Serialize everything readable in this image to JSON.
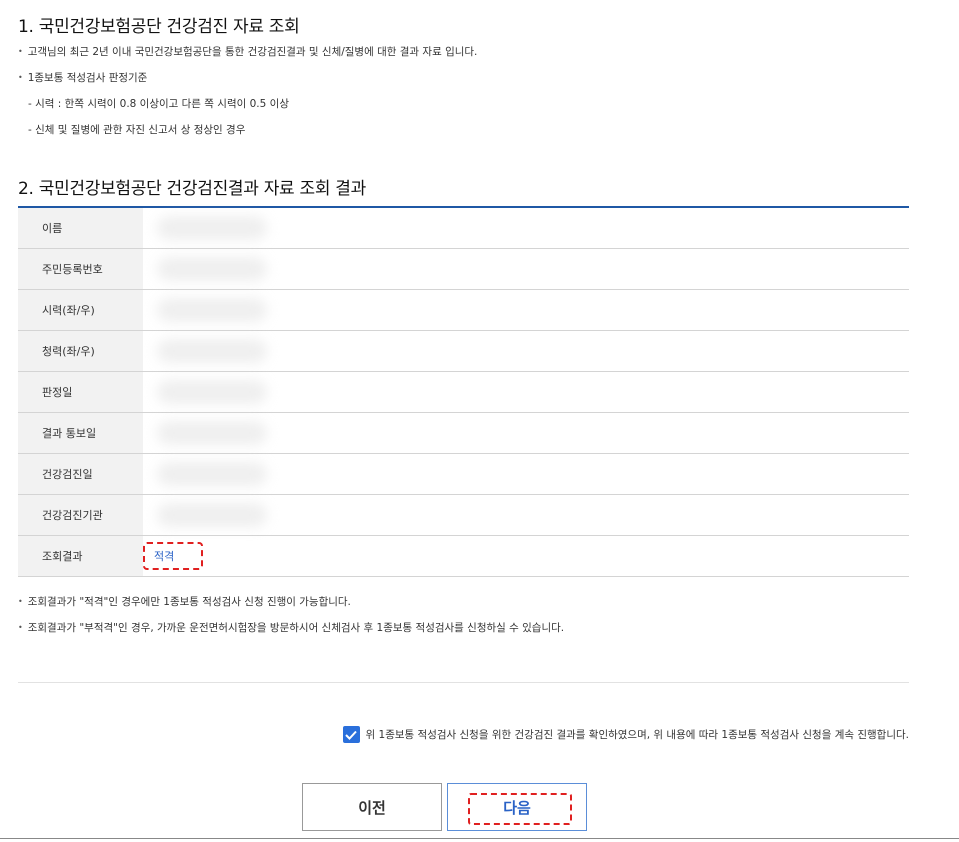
{
  "section1": {
    "title": "1. 국민건강보험공단 건강검진 자료 조회",
    "bullets": [
      "고객님의 최근 2년 이내 국민건강보험공단을 통한 건강검진결과 및 신체/질병에 대한 결과 자료 입니다.",
      "1종보통 적성검사 판정기준"
    ],
    "criteria": [
      "- 시력 : 한쪽 시력이 0.8 이상이고 다른 쪽 시력이 0.5 이상",
      "- 신체 및 질병에 관한 자진 신고서 상 정상인 경우"
    ]
  },
  "section2": {
    "title": "2. 국민건강보험공단 건강검진결과 자료 조회 결과",
    "rows": [
      {
        "label": "이름",
        "value": ""
      },
      {
        "label": "주민등록번호",
        "value": ""
      },
      {
        "label": "시력(좌/우)",
        "value": ""
      },
      {
        "label": "청력(좌/우)",
        "value": ""
      },
      {
        "label": "판정일",
        "value": ""
      },
      {
        "label": "결과 통보일",
        "value": ""
      },
      {
        "label": "건강검진일",
        "value": ""
      },
      {
        "label": "건강검진기관",
        "value": ""
      }
    ],
    "result_label": "조회결과",
    "result_value": "적격"
  },
  "notes": [
    "조회결과가 \"적격\"인 경우에만 1종보통 적성검사 신청 진행이 가능합니다.",
    "조회결과가 \"부적격\"인 경우, 가까운 운전면허시험장을 방문하시어 신체검사 후 1종보통 적성검사를 신청하실 수 있습니다."
  ],
  "confirm": {
    "checked": true,
    "text": "위 1종보통 적성검사 신청을 위한 건강검진 결과를 확인하였으며, 위 내용에 따라 1종보통 적성검사 신청을 계속 진행합니다."
  },
  "buttons": {
    "prev": "이전",
    "next": "다음"
  },
  "colors": {
    "accent": "#1f58a5",
    "checkbox": "#2a6fdb",
    "highlight": "#e02020",
    "link": "#2a62c6"
  }
}
